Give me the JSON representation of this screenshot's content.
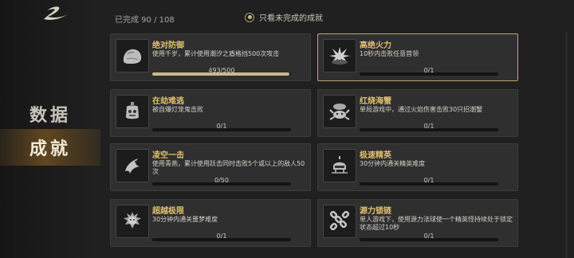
{
  "header": {
    "completed_count": "已完成 90 / 108",
    "filter_label": "只看未完成的成就"
  },
  "sidebar": {
    "items": [
      {
        "label": "数据",
        "active": false
      },
      {
        "label": "成就",
        "active": true
      }
    ]
  },
  "achievements": [
    {
      "title": "绝对防御",
      "desc": "使用千岁，累计使用潮汐之盾格挡500次攻击",
      "progress": "493/500",
      "fraction": 0.986,
      "icon": "rock-shield-icon",
      "selected": false
    },
    {
      "title": "高绝火力",
      "desc": "10秒内击败任意首领",
      "progress": "0/1",
      "fraction": 0,
      "icon": "burst-fire-icon",
      "selected": true
    },
    {
      "title": "在劫难逃",
      "desc": "被自爆灯笼鬼击败",
      "progress": "0/1",
      "fraction": 0,
      "icon": "lantern-ghost-icon",
      "selected": false
    },
    {
      "title": "红烧海蟹",
      "desc": "单局游戏中，通过火焰伤害击败30只招潮蟹",
      "progress": "0/1",
      "fraction": 0,
      "icon": "crab-icon",
      "selected": false
    },
    {
      "title": "凌空一击",
      "desc": "使用青燕，累计使用跃击同时击败5个或以上的敌人50次",
      "progress": "0/50",
      "fraction": 0,
      "icon": "swallow-icon",
      "selected": false
    },
    {
      "title": "极速精英",
      "desc": "30分钟内通关精英难度",
      "progress": "0/1",
      "fraction": 0,
      "icon": "elite-helmet-icon",
      "selected": false
    },
    {
      "title": "超越极限",
      "desc": "30分钟内通关噩梦难度",
      "progress": "0/1",
      "fraction": 0,
      "icon": "nightmare-face-icon",
      "selected": false
    },
    {
      "title": "源力锁链",
      "desc": "单人游戏下，使用源力法球使一个精英怪持续处于锁定状态超过10秒",
      "progress": "0/1",
      "fraction": 0,
      "icon": "chain-icon",
      "selected": false
    }
  ],
  "colors": {
    "accent_gold": "#e0c070",
    "selected_border": "#bfa56d",
    "progress_fill": "#c9b78f",
    "active_nav": "#8a6430"
  }
}
